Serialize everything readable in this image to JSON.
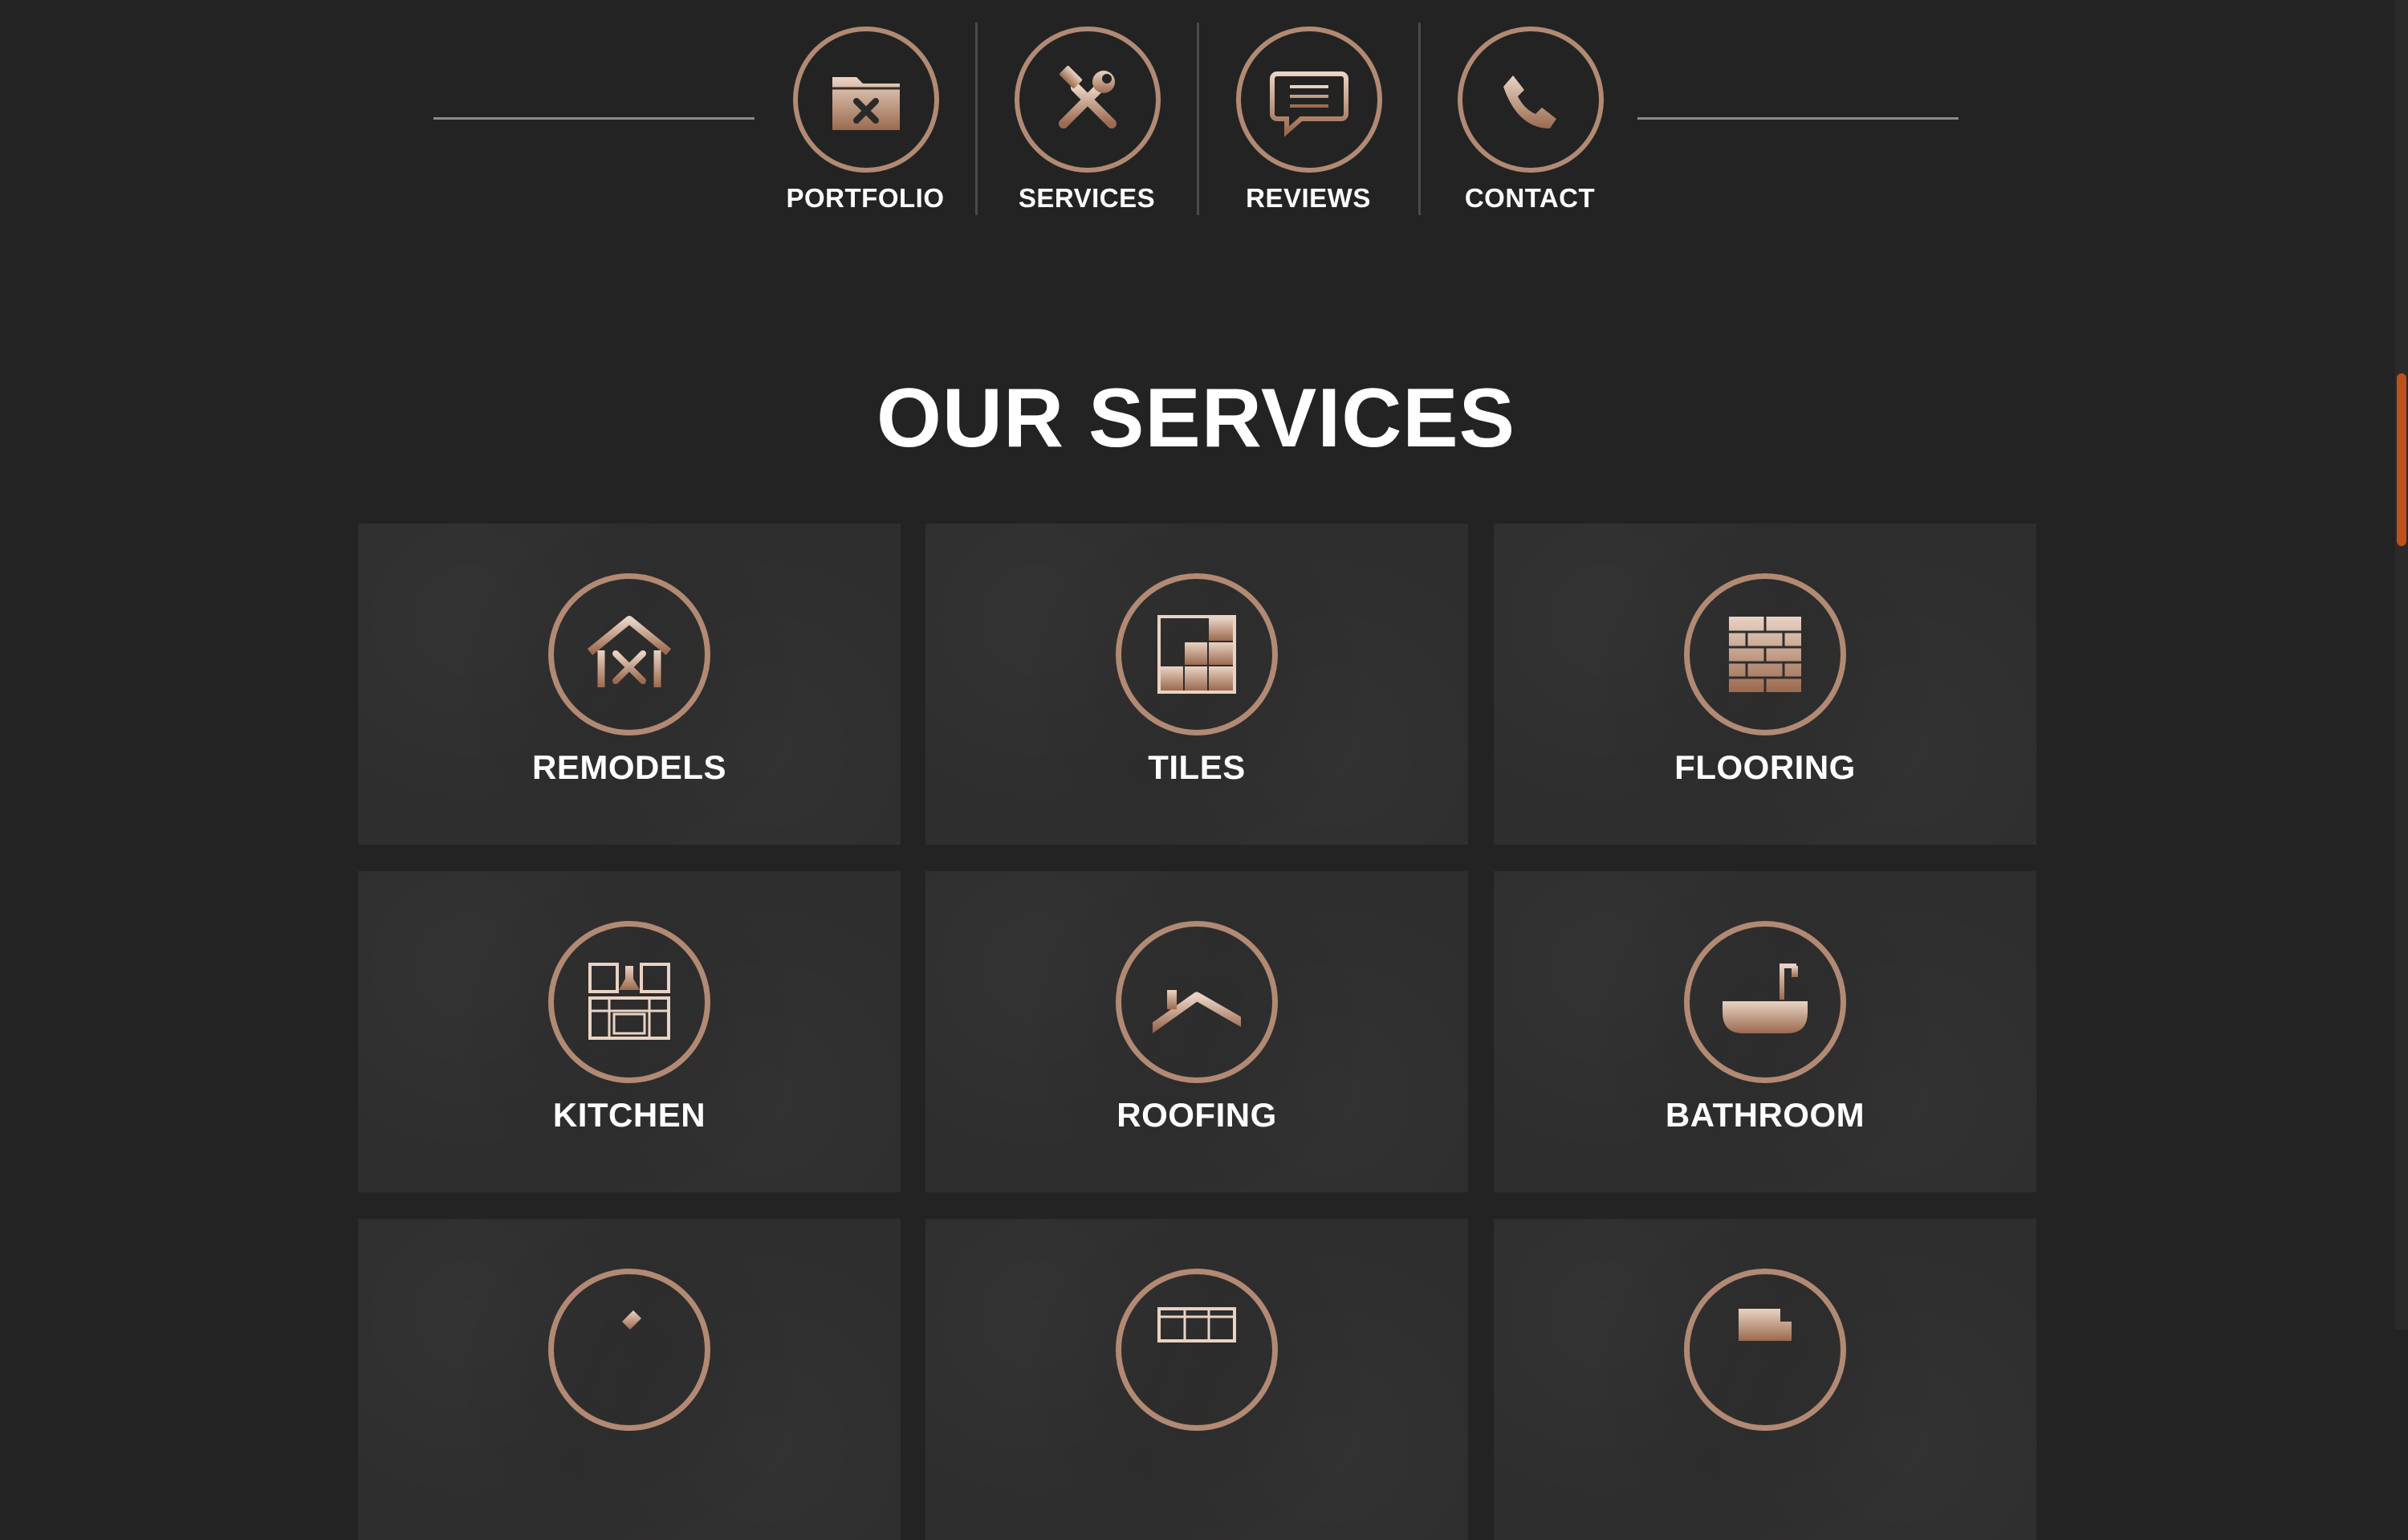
{
  "nav": {
    "items": [
      {
        "label": "PORTFOLIO",
        "icon": "folder-pencil-icon"
      },
      {
        "label": "SERVICES",
        "icon": "tools-icon"
      },
      {
        "label": "REVIEWS",
        "icon": "speech-bubble-icon"
      },
      {
        "label": "CONTACT",
        "icon": "phone-icon"
      }
    ]
  },
  "section": {
    "title": "OUR SERVICES"
  },
  "services": [
    {
      "label": "REMODELS",
      "icon": "house-tools-icon"
    },
    {
      "label": "TILES",
      "icon": "tiles-icon"
    },
    {
      "label": "FLOORING",
      "icon": "brick-flooring-icon"
    },
    {
      "label": "KITCHEN",
      "icon": "kitchen-cabinets-icon"
    },
    {
      "label": "ROOFING",
      "icon": "roof-icon"
    },
    {
      "label": "BATHROOM",
      "icon": "bathtub-icon"
    }
  ],
  "colors": {
    "background": "#232323",
    "card": "#2f2e2e",
    "accent": "#b28a74",
    "scrollbar": "#c0501a",
    "text": "#ffffff"
  }
}
